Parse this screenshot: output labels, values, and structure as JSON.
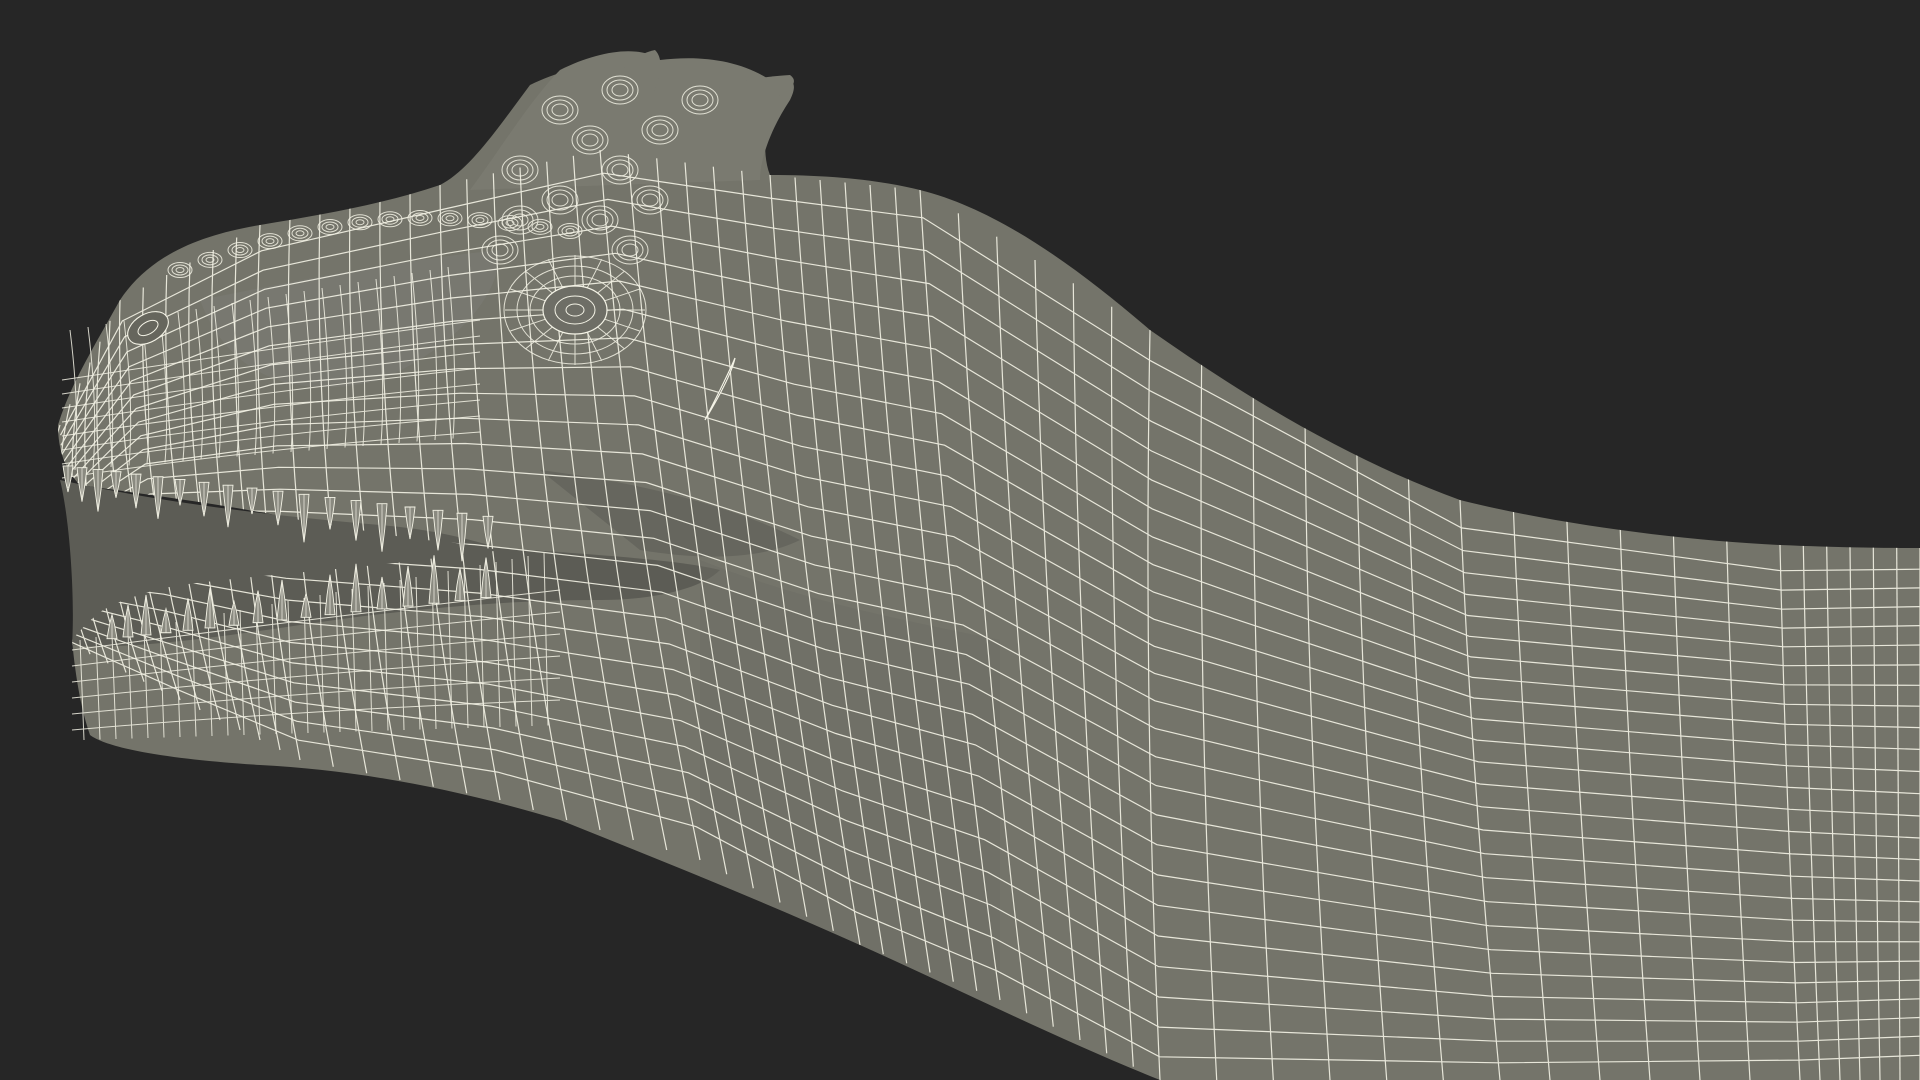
{
  "scene": {
    "subject": "dinosaur-head-wireframe",
    "colors": {
      "background": "#262626",
      "surface": "#74746a",
      "surface_shade": "#66665d",
      "surface_light": "#80807a",
      "wire": "#f4f3e6",
      "mouth_interior": "#5c5c55",
      "tooth": "#8a8a80"
    }
  }
}
